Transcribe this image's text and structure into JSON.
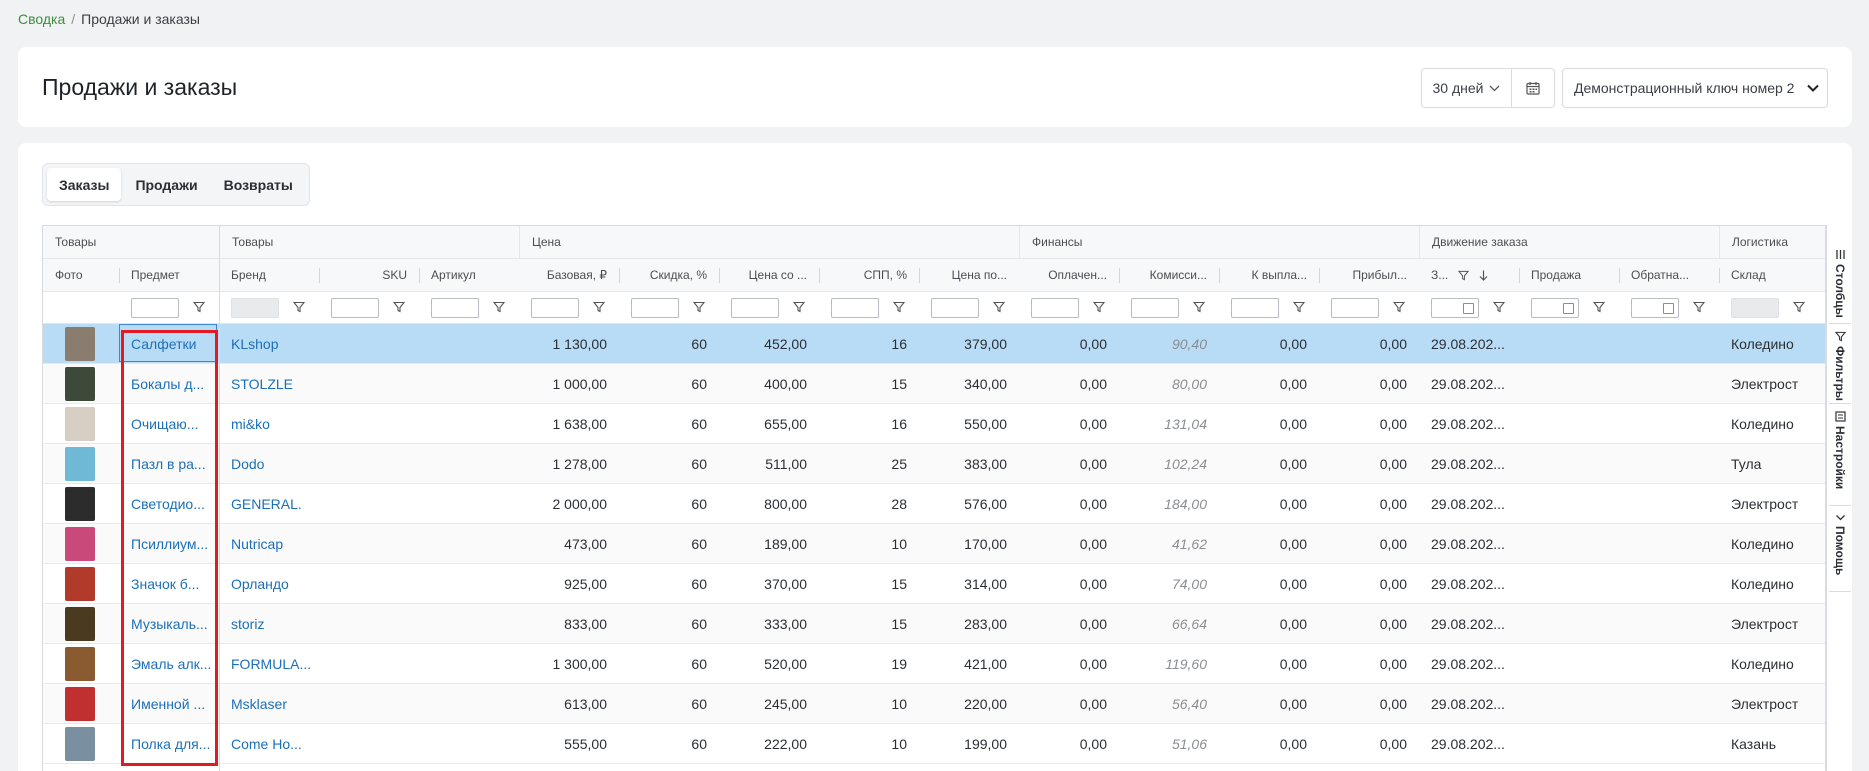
{
  "breadcrumb": {
    "root": "Сводка",
    "separator": "/",
    "current": "Продажи и заказы"
  },
  "header": {
    "title": "Продажи и заказы",
    "period": "30 дней",
    "api_key": "Демонстрационный ключ номер 2"
  },
  "tabs": [
    {
      "label": "Заказы",
      "active": true
    },
    {
      "label": "Продажи",
      "active": false
    },
    {
      "label": "Возвраты",
      "active": false
    }
  ],
  "groups": [
    "Товары",
    "Товары",
    "Цена",
    "Финансы",
    "Движение заказа",
    "Логистика"
  ],
  "columns": [
    "Фото",
    "Предмет",
    "Бренд",
    "SKU",
    "Артикул",
    "Базовая, ₽",
    "Скидка, %",
    "Цена со ...",
    "СПП, %",
    "Цена по...",
    "Оплачен...",
    "Комисси...",
    "К выпла...",
    "Прибыл...",
    "З...",
    "Продажа",
    "Обратна...",
    "Склад"
  ],
  "rows": [
    {
      "subject": "Салфетки",
      "brand": "KLshop",
      "base": "1 130,00",
      "discount": "60",
      "price_with": "452,00",
      "spp": "16",
      "price_after": "379,00",
      "paid": "0,00",
      "commission": "90,40",
      "payout": "0,00",
      "profit": "0,00",
      "date": "29.08.202...",
      "sale": "",
      "back": "",
      "warehouse": "Коледино"
    },
    {
      "subject": "Бокалы д...",
      "brand": "STOLZLE",
      "base": "1 000,00",
      "discount": "60",
      "price_with": "400,00",
      "spp": "15",
      "price_after": "340,00",
      "paid": "0,00",
      "commission": "80,00",
      "payout": "0,00",
      "profit": "0,00",
      "date": "29.08.202...",
      "sale": "",
      "back": "",
      "warehouse": "Электрост"
    },
    {
      "subject": "Очищаю...",
      "brand": "mi&ko",
      "base": "1 638,00",
      "discount": "60",
      "price_with": "655,00",
      "spp": "16",
      "price_after": "550,00",
      "paid": "0,00",
      "commission": "131,04",
      "payout": "0,00",
      "profit": "0,00",
      "date": "29.08.202...",
      "sale": "",
      "back": "",
      "warehouse": "Коледино"
    },
    {
      "subject": "Пазл в ра...",
      "brand": "Dodo",
      "base": "1 278,00",
      "discount": "60",
      "price_with": "511,00",
      "spp": "25",
      "price_after": "383,00",
      "paid": "0,00",
      "commission": "102,24",
      "payout": "0,00",
      "profit": "0,00",
      "date": "29.08.202...",
      "sale": "",
      "back": "",
      "warehouse": "Тула"
    },
    {
      "subject": "Светодио...",
      "brand": "GENERAL.",
      "base": "2 000,00",
      "discount": "60",
      "price_with": "800,00",
      "spp": "28",
      "price_after": "576,00",
      "paid": "0,00",
      "commission": "184,00",
      "payout": "0,00",
      "profit": "0,00",
      "date": "29.08.202...",
      "sale": "",
      "back": "",
      "warehouse": "Электрост"
    },
    {
      "subject": "Псиллиум...",
      "brand": "Nutricap",
      "base": "473,00",
      "discount": "60",
      "price_with": "189,00",
      "spp": "10",
      "price_after": "170,00",
      "paid": "0,00",
      "commission": "41,62",
      "payout": "0,00",
      "profit": "0,00",
      "date": "29.08.202...",
      "sale": "",
      "back": "",
      "warehouse": "Коледино"
    },
    {
      "subject": "Значок б...",
      "brand": "Орландо",
      "base": "925,00",
      "discount": "60",
      "price_with": "370,00",
      "spp": "15",
      "price_after": "314,00",
      "paid": "0,00",
      "commission": "74,00",
      "payout": "0,00",
      "profit": "0,00",
      "date": "29.08.202...",
      "sale": "",
      "back": "",
      "warehouse": "Коледино"
    },
    {
      "subject": "Музыкаль...",
      "brand": "storiz",
      "base": "833,00",
      "discount": "60",
      "price_with": "333,00",
      "spp": "15",
      "price_after": "283,00",
      "paid": "0,00",
      "commission": "66,64",
      "payout": "0,00",
      "profit": "0,00",
      "date": "29.08.202...",
      "sale": "",
      "back": "",
      "warehouse": "Электрост"
    },
    {
      "subject": "Эмаль алк...",
      "brand": "FORMULA...",
      "base": "1 300,00",
      "discount": "60",
      "price_with": "520,00",
      "spp": "19",
      "price_after": "421,00",
      "paid": "0,00",
      "commission": "119,60",
      "payout": "0,00",
      "profit": "0,00",
      "date": "29.08.202...",
      "sale": "",
      "back": "",
      "warehouse": "Коледино"
    },
    {
      "subject": "Именной ...",
      "brand": "Msklaser",
      "base": "613,00",
      "discount": "60",
      "price_with": "245,00",
      "spp": "10",
      "price_after": "220,00",
      "paid": "0,00",
      "commission": "56,40",
      "payout": "0,00",
      "profit": "0,00",
      "date": "29.08.202...",
      "sale": "",
      "back": "",
      "warehouse": "Электрост"
    },
    {
      "subject": "Полка для...",
      "brand": "Come Ho...",
      "base": "555,00",
      "discount": "60",
      "price_with": "222,00",
      "spp": "10",
      "price_after": "199,00",
      "paid": "0,00",
      "commission": "51,06",
      "payout": "0,00",
      "profit": "0,00",
      "date": "29.08.202...",
      "sale": "",
      "back": "",
      "warehouse": "Казань"
    }
  ],
  "thumb_colors": [
    "#8a7d70",
    "#3d4a3a",
    "#d8cfc4",
    "#6fb8d6",
    "#2c2c2c",
    "#c94a7a",
    "#b23a2a",
    "#4a3a20",
    "#8a5a30",
    "#c03030",
    "#7a8fa0"
  ],
  "side_panel": [
    "Столбцы",
    "Фильтры",
    "Настройки",
    "Помощь"
  ]
}
